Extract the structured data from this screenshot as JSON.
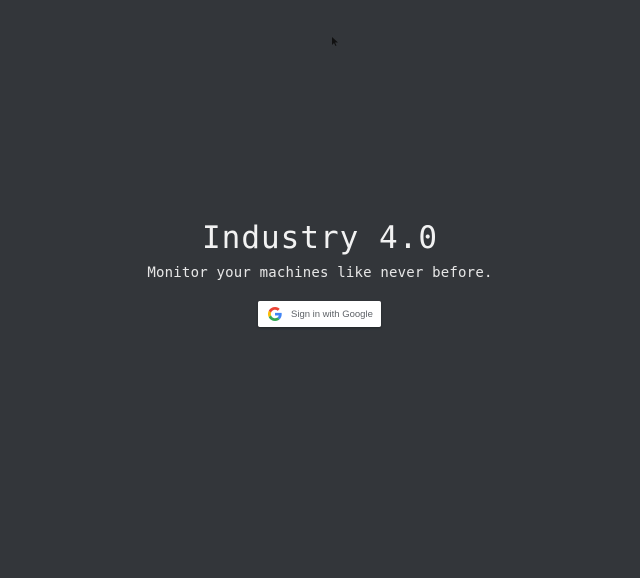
{
  "hero": {
    "title": "Industry 4.0",
    "subtitle": "Monitor your machines like never before."
  },
  "signin": {
    "label": "Sign in with Google",
    "icon": "google-g-icon"
  },
  "colors": {
    "background": "#33363a",
    "title_text": "#f2f2f2",
    "button_bg": "#ffffff",
    "button_text": "#5f6368"
  }
}
